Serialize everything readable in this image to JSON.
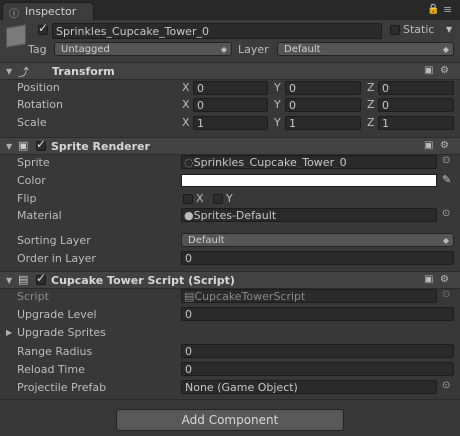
{
  "tab": {
    "title": "Inspector"
  },
  "object": {
    "name": "Sprinkles_Cupcake_Tower_0",
    "static_label": "Static",
    "tag_label": "Tag",
    "tag_value": "Untagged",
    "layer_label": "Layer",
    "layer_value": "Default"
  },
  "transform": {
    "title": "Transform",
    "rows": [
      {
        "label": "Position",
        "x": "0",
        "y": "0",
        "z": "0"
      },
      {
        "label": "Rotation",
        "x": "0",
        "y": "0",
        "z": "0"
      },
      {
        "label": "Scale",
        "x": "1",
        "y": "1",
        "z": "1"
      }
    ],
    "axis": {
      "x": "X",
      "y": "Y",
      "z": "Z"
    }
  },
  "sprite_renderer": {
    "title": "Sprite Renderer",
    "sprite_label": "Sprite",
    "sprite_value": "Sprinkles_Cupcake_Tower_0",
    "color_label": "Color",
    "color_value": "#ffffff",
    "flip_label": "Flip",
    "flip_x": "X",
    "flip_y": "Y",
    "material_label": "Material",
    "material_value": "Sprites-Default",
    "sorting_layer_label": "Sorting Layer",
    "sorting_layer_value": "Default",
    "order_label": "Order in Layer",
    "order_value": "0"
  },
  "script": {
    "title": "Cupcake Tower Script (Script)",
    "script_label": "Script",
    "script_value": "CupcakeTowerScript",
    "upgrade_level_label": "Upgrade Level",
    "upgrade_level_value": "0",
    "upgrade_sprites_label": "Upgrade Sprites",
    "range_radius_label": "Range Radius",
    "range_radius_value": "0",
    "reload_time_label": "Reload Time",
    "reload_time_value": "0",
    "projectile_label": "Projectile Prefab",
    "projectile_value": "None (Game Object)"
  },
  "add_component": {
    "label": "Add Component"
  }
}
